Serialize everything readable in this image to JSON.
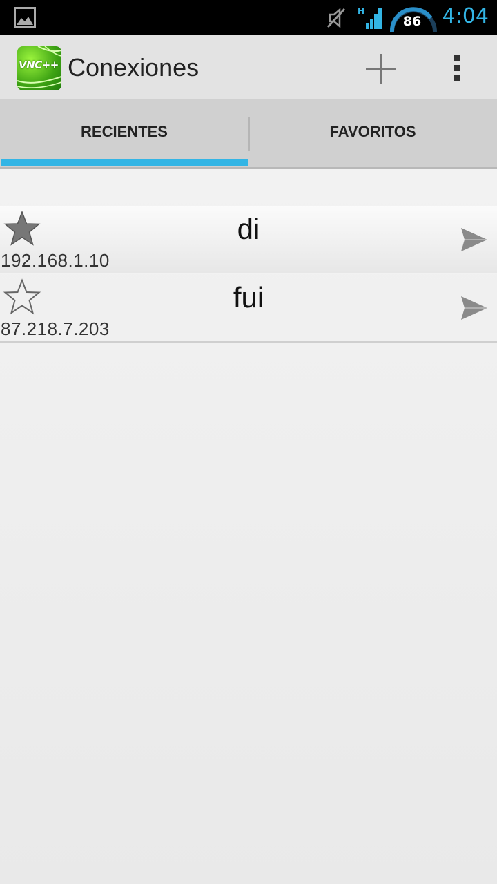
{
  "status_bar": {
    "battery_level": "86",
    "time": "4:04"
  },
  "action_bar": {
    "logo_text": "VNC++",
    "title": "Conexiones",
    "add_icon": "plus-icon",
    "overflow_icon": "overflow-menu-icon"
  },
  "tabs": [
    {
      "label": "RECIENTES",
      "selected": true
    },
    {
      "label": "FAVORITOS",
      "selected": false
    }
  ],
  "connections": [
    {
      "name": "di",
      "address": "192.168.1.10",
      "favorite": true
    },
    {
      "name": "fui",
      "address": "87.218.7.203",
      "favorite": false
    }
  ],
  "colors": {
    "accent": "#33b5e5",
    "status_bar": "#000000",
    "action_bar": "#e3e3e3",
    "tab_bar": "#d0d0d0"
  }
}
